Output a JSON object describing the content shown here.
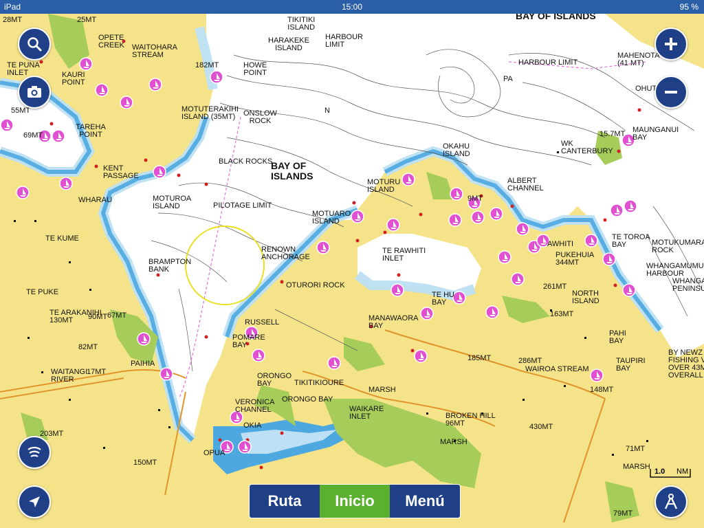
{
  "status_bar": {
    "device": "iPad",
    "time": "15:00",
    "battery": "95 %"
  },
  "controls": {
    "search": "search-icon",
    "camera": "camera-icon",
    "zoom_in": "plus-icon",
    "zoom_out": "minus-icon",
    "sonar": "sonar-icon",
    "locate": "location-arrow-icon",
    "compass": "compass-icon"
  },
  "bottom_nav": {
    "route": "Ruta",
    "home": "Inicio",
    "menu": "Menú",
    "active": "Inicio"
  },
  "scale": {
    "value": "1.0",
    "unit": "NM"
  },
  "colors": {
    "land": "#f5e38a",
    "deep_water": "#ffffff",
    "shallow_water": "#4da8e0",
    "mid_water": "#bde0f4",
    "vegetation": "#a6cc5a",
    "pink_marker": "#e050d0",
    "route_line": "#e070e0"
  },
  "labels": {
    "bay_of_islands_top": "BAY OF ISLANDS",
    "bay_of_islands_main": "BAY OF\nISLANDS",
    "tikitiki": "TIKITIKI\nISLAND",
    "harakeke": "HARAKEKE\nISLAND",
    "harbour_limit_1": "HARBOUR\nLIMIT",
    "harbour_limit_2": "HARBOUR LIMIT",
    "mahenotahi": "MAHENOTA\n(41 MT)",
    "ohu": "OHUT",
    "pa": "PA",
    "opete": "OPETE\nCREEK",
    "waitohara": "WAITOHARA\nSTREAM",
    "te_puna": "TE PUNA\nINLET",
    "kauri": "KAURI\nPOINT",
    "m182": "182MT",
    "howe": "HOWE\nPOINT",
    "moturerakihi": "MOTUTERAKIHI\nISLAND (35MT)",
    "onslow": "ONSLOW\nROCK",
    "n_marker": "N",
    "tareha": "TAREHA\nPOINT",
    "kent": "KENT\nPASSAGE",
    "black_rocks": "BLACK ROCKS",
    "wharau": "WHARAU",
    "moturoa": "MOTUROA\nISLAND",
    "pilotage": "PILOTAGE LIMIT",
    "okahu": "OKAHU\nISLAND",
    "motuaru": "MOTURU\nISLAND",
    "albert": "ALBERT\nCHANNEL",
    "maunganui": "MAUNGANUI\nBAY",
    "wk_canterbury": "WK\nCANTERBURY",
    "m157": "15.7MT",
    "te_kume": "TE KUME",
    "motuarohia": "MOTUARO\nISLAND",
    "renown": "RENOWN\nANCHORAGE",
    "brampton": "BRAMPTON\nBANK",
    "te_rawhiti": "TE RAWHITI\nINLET",
    "te_toroa": "TE TOROA\nBAY",
    "motukumara": "MOTUKUMARA\nROCK",
    "whangamumu": "WHANGAMUMU\nHARBOUR",
    "whangai": "WHANGAI\nPENINSU",
    "awhiti": "AWHITI",
    "pukehuia": "PUKEHUIA\n344MT",
    "m261": "261MT",
    "north_island": "NORTH\nISLAND",
    "te_puke": "TE PUKE",
    "oturori": "OTURORI ROCK",
    "te_hu": "TE HU\nBAY",
    "te_arakanihi": "TE ARAKANIHI\n130MT",
    "m90": "90MT",
    "m67": "67MT",
    "russell": "RUSSELL",
    "manawaora": "MANAWAORA\nBAY",
    "m163": "163MT",
    "m82": "82MT",
    "pomare": "POMARE\nBAY",
    "paihia": "PAIHIA",
    "m185": "185MT",
    "m286": "286MT",
    "pahi": "PAHI\nBAY",
    "taupiri": "TAUPIRI\nBAY",
    "fishing_note": "BY NEWZ\nFISHING V\nOVER 43M\nOVERALL",
    "waitangi": "WAITANGI\nRIVER",
    "m17": "17MT",
    "orongo_bay": "ORONGO\nBAY",
    "tikitikioure": "TIKITIKIOURE",
    "wairoa": "WAIROA STREAM",
    "m148": "148MT",
    "marsh1": "MARSH",
    "veronica": "VERONICA\nCHANNEL",
    "orongo_bay2": "ORONGO BAY",
    "waikare": "WAIKARE\nINLET",
    "broken_hill": "BROKEN HILL\n96MT",
    "m430": "430MT",
    "m203": "203MT",
    "okiato": "OKIA",
    "marsh2": "MARSH",
    "m71": "71MT",
    "m150": "150MT",
    "opua": "OPUA",
    "marsh3": "MARSH",
    "m79": "79MT",
    "m55": "55MT",
    "m25": "25MT",
    "m28": "28MT",
    "m69": "69MT",
    "m9": "9MT"
  }
}
